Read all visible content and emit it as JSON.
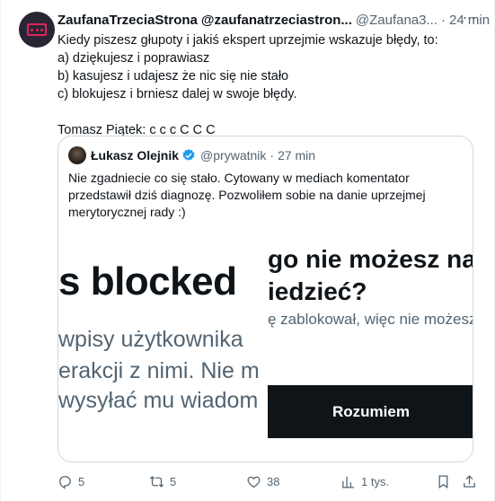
{
  "tweet": {
    "author_name": "ZaufanaTrzeciaStrona",
    "author_handle": "@zaufanatrzeciastron...",
    "author_handle_short": "@Zaufana3...",
    "separator": "·",
    "time": "24 min",
    "text_lines": [
      "Kiedy piszesz głupoty i jakiś ekspert uprzejmie wskazuje błędy, to:",
      "a) dziękujesz i poprawiasz",
      "b) kasujesz i udajesz że nic się nie stało",
      "c) blokujesz i brniesz dalej w swoje błędy.",
      "",
      "Tomasz Piątek: c c c C C C"
    ]
  },
  "quote": {
    "author_name": "Łukasz Olejnik",
    "author_handle": "@prywatnik",
    "separator": "·",
    "time": "27 min",
    "text_lines": [
      "Nie zgadniecie co się stało. Cytowany w mediach komentator",
      "przedstawił dziś diagnozę. Pozwoliłem sobie na danie uprzejmej",
      "merytorycznej rady :)"
    ],
    "media": {
      "left_title": "s blocked",
      "left_lines": [
        "wpisy użytkownika",
        "erakcji z nimi. Nie m",
        "wysyłać mu wiadom"
      ],
      "right_title_lines": [
        "go nie możesz na",
        "iedzieć?"
      ],
      "right_sub": "ę zablokował, więc nie możesz",
      "button_label": "Rozumiem"
    }
  },
  "actions": {
    "replies": "5",
    "retweets": "5",
    "likes": "38",
    "views": "1 tys."
  },
  "colors": {
    "text": "#0f1419",
    "secondary": "#536471",
    "border": "#cfd9de",
    "verified": "#1d9bf0"
  }
}
